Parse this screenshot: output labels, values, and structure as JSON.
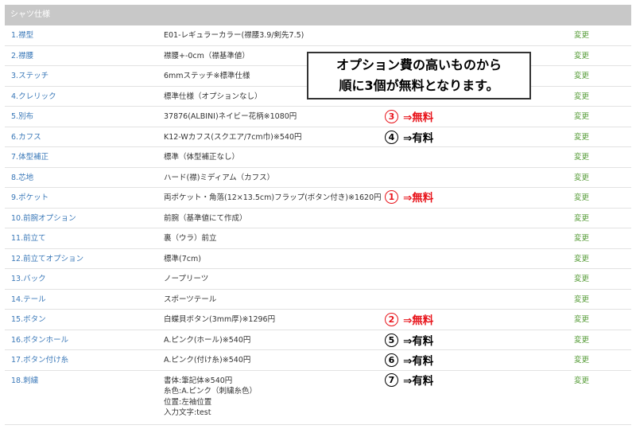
{
  "header": {
    "title": "シャツ仕様"
  },
  "change_label": "変更",
  "rows": [
    {
      "label": "1.襟型",
      "value": "E01-レギュラーカラー(襟腰3.9/剣先7.5)"
    },
    {
      "label": "2.襟腰",
      "value": "襟腰+-0cm（襟基準値）"
    },
    {
      "label": "3.ステッチ",
      "value": "6mmステッチ※標準仕様"
    },
    {
      "label": "4.クレリック",
      "value": "標準仕様（オプションなし）"
    },
    {
      "label": "5.別布",
      "value": "37876(ALBINI)ネイビー花柄※1080円"
    },
    {
      "label": "6.カフス",
      "value": "K12-Wカフス(スクエア/7cm巾)※540円"
    },
    {
      "label": "7.体型補正",
      "value": "標準（体型補正なし）"
    },
    {
      "label": "8.芯地",
      "value": "ハード(襟)ミディアム（カフス）"
    },
    {
      "label": "9.ポケット",
      "value": "両ポケット・角落(12×13.5cm)フラップ(ボタン付き)※1620円"
    },
    {
      "label": "10.前腕オプション",
      "value": "前腕（基準値にて作成）"
    },
    {
      "label": "11.前立て",
      "value": "裏（ウラ）前立"
    },
    {
      "label": "12.前立てオプション",
      "value": "標準(7cm)"
    },
    {
      "label": "13.バック",
      "value": "ノープリーツ"
    },
    {
      "label": "14.テール",
      "value": "スポーツテール"
    },
    {
      "label": "15.ボタン",
      "value": "白蝶貝ボタン(3mm厚)※1296円"
    },
    {
      "label": "16.ボタンホール",
      "value": "A.ピンク(ホール)※540円"
    },
    {
      "label": "17.ボタン付け糸",
      "value": "A.ピンク(付け糸)※540円"
    },
    {
      "label": "18.刺繍",
      "lines": [
        "書体:筆記体※540円",
        "糸色:A.ピンク（刺繍糸色）",
        "位置:左袖位置",
        "入力文字:test"
      ]
    }
  ],
  "callout": {
    "line1": "オプション費の高いものから",
    "line2": "順に3個が無料となります。"
  },
  "annotations": [
    {
      "rank": "3",
      "text": "⇒無料",
      "color": "#e8141b"
    },
    {
      "rank": "4",
      "text": "⇒有料",
      "color": "#000000"
    },
    {
      "rank": "1",
      "text": "⇒無料",
      "color": "#e8141b"
    },
    {
      "rank": "2",
      "text": "⇒無料",
      "color": "#e8141b"
    },
    {
      "rank": "5",
      "text": "⇒有料",
      "color": "#000000"
    },
    {
      "rank": "6",
      "text": "⇒有料",
      "color": "#000000"
    },
    {
      "rank": "7",
      "text": "⇒有料",
      "color": "#000000"
    }
  ],
  "colors": {
    "header_bg": "#c8c8c8",
    "label": "#3a78b8",
    "change_link": "#5a9e3c",
    "free": "#e8141b",
    "paid": "#000000"
  }
}
